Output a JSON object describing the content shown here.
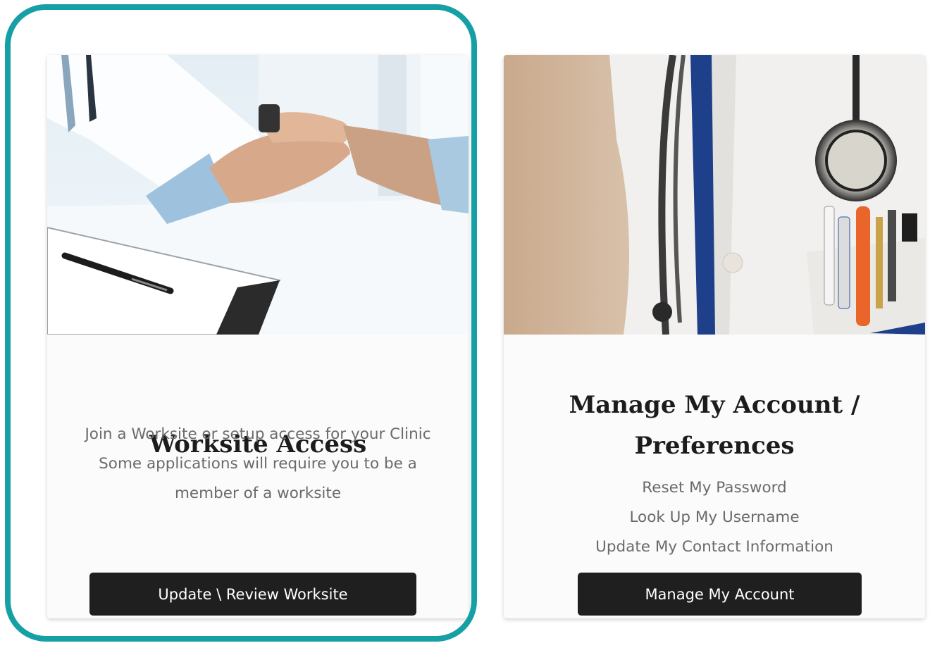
{
  "cards": [
    {
      "image": "doctor-holding-patient-hands-photo",
      "title": "Worksite Access",
      "lines": [
        "Join a Worksite or setup access for your Clinic",
        "Some applications will require you to be a",
        "member of a worksite"
      ],
      "button_label": "Update \\ Review Worksite"
    },
    {
      "image": "doctor-coat-with-stethoscope-photo",
      "title_lines": [
        "Manage My Account /",
        "Preferences"
      ],
      "lines": [
        "Reset My Password",
        "Look Up My Username",
        "Update My Contact Information"
      ],
      "button_label": "Manage My Account"
    }
  ],
  "colors": {
    "highlight": "#16a0a6",
    "button": "#1f1f1f",
    "title": "#1c1c1c",
    "body_text": "#6a6a6a"
  }
}
